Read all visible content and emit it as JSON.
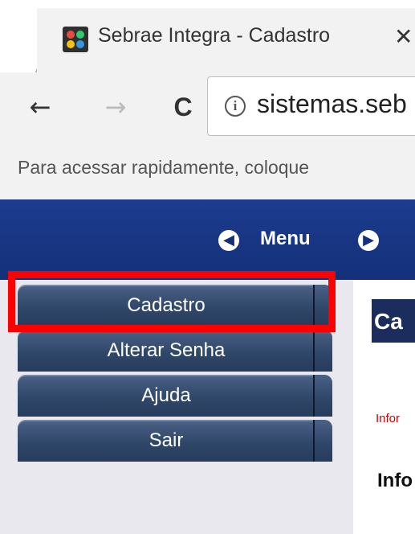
{
  "browser": {
    "tab_title": "Sebrae Integra - Cadastro",
    "close_glyph": "✕",
    "url": "sistemas.seb",
    "back_glyph": "←",
    "forward_glyph": "→",
    "reload_glyph": "C",
    "info_glyph": "i",
    "bookmark_bar_hint": "Para acessar rapidamente, coloque"
  },
  "header": {
    "menu_label": "Menu",
    "prev_icon": "arrow-left-icon",
    "next_icon": "arrow-right-icon"
  },
  "sidebar": {
    "items": [
      {
        "label": "Cadastro"
      },
      {
        "label": "Alterar Senha"
      },
      {
        "label": "Ajuda"
      },
      {
        "label": "Sair"
      }
    ]
  },
  "content": {
    "title": "Ca",
    "info_red": "Infor",
    "info_bold": "Info"
  },
  "colors": {
    "header_blue": "#14307a",
    "menu_item": "#2f4769",
    "highlight": "#ff0000",
    "info_red": "#d40000"
  }
}
